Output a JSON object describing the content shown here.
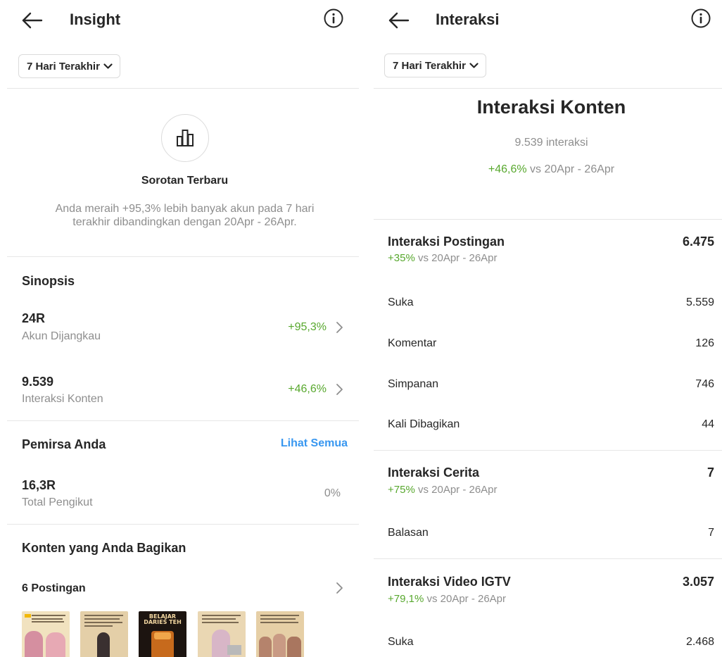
{
  "left": {
    "header": {
      "title": "Insight"
    },
    "range": {
      "label": "7 Hari Terakhir"
    },
    "highlight": {
      "title": "Sorotan Terbaru",
      "line1": "Anda meraih +95,3% lebih banyak akun pada 7 hari",
      "line2": "terakhir dibandingkan dengan 20Apr - 26Apr."
    },
    "synopsis": {
      "title": "Sinopsis",
      "items": [
        {
          "value": "24R",
          "label": "Akun Dijangkau",
          "change": "+95,3%"
        },
        {
          "value": "9.539",
          "label": "Interaksi Konten",
          "change": "+46,6%"
        }
      ]
    },
    "audience": {
      "title": "Pemirsa Anda",
      "see_all": "Lihat Semua",
      "value": "16,3R",
      "label": "Total Pengikut",
      "change": "0%"
    },
    "content": {
      "title": "Konten yang Anda Bagikan",
      "posts_label": "6 Postingan",
      "thumb3_line1": "BELAJAR",
      "thumb3_line2": "DARIES TEH"
    }
  },
  "right": {
    "header": {
      "title": "Interaksi"
    },
    "range": {
      "label": "7 Hari Terakhir"
    },
    "summary": {
      "title": "Interaksi Konten",
      "count": "9.539 interaksi",
      "change": "+46,6%",
      "compare": " vs 20Apr - 26Apr"
    },
    "groups": {
      "posts": {
        "title": "Interaksi Postingan",
        "total": "6.475",
        "change": "+35%",
        "compare": " vs 20Apr - 26Apr",
        "rows": [
          {
            "label": "Suka",
            "value": "5.559"
          },
          {
            "label": "Komentar",
            "value": "126"
          },
          {
            "label": "Simpanan",
            "value": "746"
          },
          {
            "label": "Kali Dibagikan",
            "value": "44"
          }
        ]
      },
      "stories": {
        "title": "Interaksi Cerita",
        "total": "7",
        "change": "+75%",
        "compare": " vs 20Apr - 26Apr",
        "rows": [
          {
            "label": "Balasan",
            "value": "7"
          }
        ]
      },
      "igtv": {
        "title": "Interaksi Video IGTV",
        "total": "3.057",
        "change": "+79,1%",
        "compare": " vs 20Apr - 26Apr",
        "rows": [
          {
            "label": "Suka",
            "value": "2.468"
          }
        ]
      }
    }
  },
  "colors": {
    "accent_blue": "#3897f0",
    "positive_green": "#58a82e",
    "muted_gray": "#8e8e8e",
    "text": "#262626"
  }
}
